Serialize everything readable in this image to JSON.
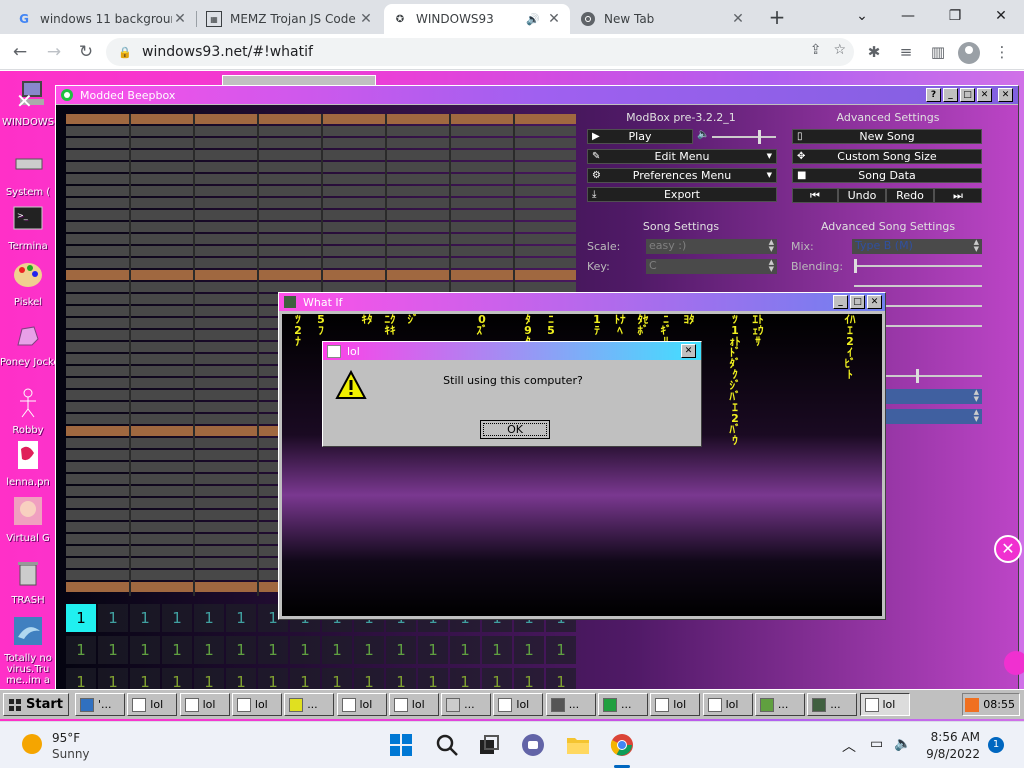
{
  "browser": {
    "tabs": [
      {
        "title": "windows 11 backgroun",
        "favicon": "G"
      },
      {
        "title": "MEMZ Trojan JS Code",
        "favicon": "M"
      },
      {
        "title": "WINDOWS93",
        "favicon": "93"
      },
      {
        "title": "New Tab",
        "favicon": "chrome"
      }
    ],
    "url": "windows93.net/#!whatif"
  },
  "desktop": {
    "icons": [
      "WINDOWS",
      "System (",
      "Termina",
      "Piskel",
      "Poney Jockey",
      "Robby",
      "lenna.pn",
      "Virtual G",
      "TRASH",
      "Totally no virus.Tru me..im a"
    ]
  },
  "beepbox": {
    "title": "Modded Beepbox",
    "version": "ModBox pre-3.2.2_1",
    "advanced_settings": "Advanced Settings",
    "play": "Play",
    "edit_menu": "Edit Menu",
    "preferences_menu": "Preferences Menu",
    "export": "Export",
    "new_song": "New Song",
    "custom_song_size": "Custom Song Size",
    "song_data": "Song Data",
    "undo": "Undo",
    "redo": "Redo",
    "song_settings": "Song Settings",
    "advanced_song_settings": "Advanced Song Settings",
    "scale_label": "Scale:",
    "scale_value": "easy :)",
    "key_label": "Key:",
    "key_value": "C",
    "mix_label": "Mix:",
    "mix_value": "Type B (M)",
    "blending_label": "Blending:",
    "patterns": [
      "1",
      "1",
      "1",
      "1",
      "1",
      "1",
      "1"
    ]
  },
  "whatif": {
    "title": "What If",
    "matrix": [
      "ﾂ2ﾅ",
      "5ﾌ",
      "",
      "ｷﾀ",
      "ﾆｸｷｷ",
      "ｼﾞ",
      "",
      "",
      "0ｽﾞ",
      "",
      "ﾀ9ﾀ",
      "ﾆ5",
      "",
      "1ﾃ",
      "ﾄﾅﾍ",
      "ﾀｾﾎﾞ",
      "ﾆｷﾞﾘ8ｹ",
      "ﾖﾀ",
      "",
      "ﾂ1ｫﾄﾄﾞﾀﾞｸｼﾞﾊﾞｴ2ﾊﾞｳ",
      "ｴﾄｪｳｻ",
      "",
      "",
      "",
      "ｲﾊｴ2ｲﾋﾞﾄ"
    ]
  },
  "lol_dialog": {
    "title": "lol",
    "message": "Still using this computer?",
    "ok": "OK"
  },
  "w93_taskbar": {
    "start": "Start",
    "items": [
      "'...",
      "lol",
      "lol",
      "lol",
      "...",
      "lol",
      "lol",
      "...",
      "lol",
      "...",
      "...",
      "lol",
      "lol",
      "...",
      "...",
      "lol"
    ],
    "clock": "08:55"
  },
  "win11_taskbar": {
    "weather_temp": "95°F",
    "weather_cond": "Sunny",
    "time": "8:56 AM",
    "date": "9/8/2022",
    "notifications": "1"
  }
}
